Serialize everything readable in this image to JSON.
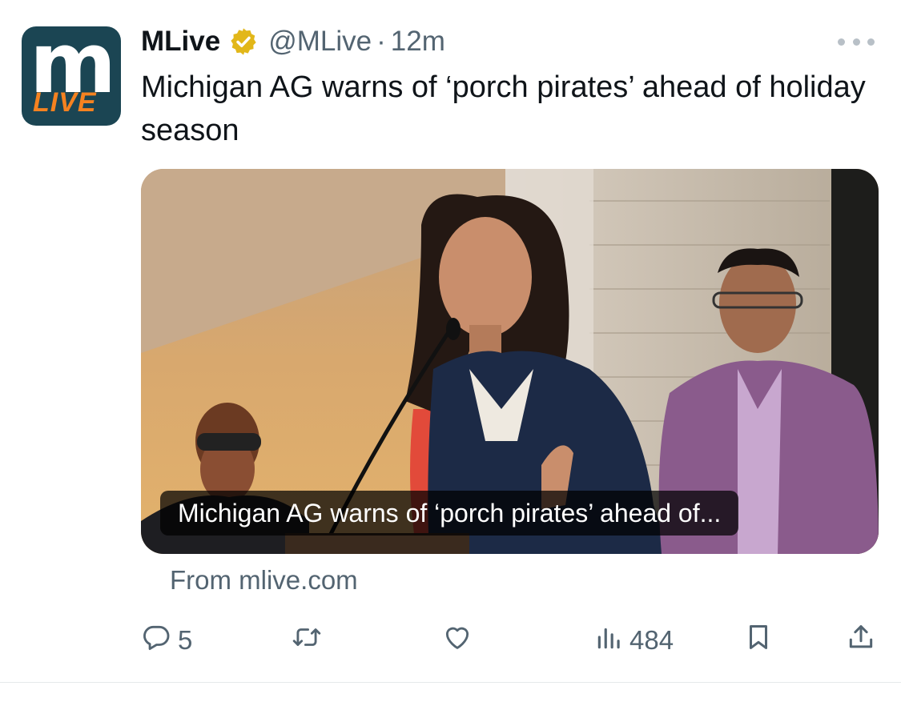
{
  "author": {
    "name": "MLive",
    "handle": "@MLive",
    "separator": "·",
    "time": "12m",
    "avatar_text_main": "m",
    "avatar_text_sub": "LIVE"
  },
  "tweet": {
    "text": "Michigan AG warns of ‘porch pirates’ ahead of holiday season"
  },
  "link_card": {
    "caption": "Michigan AG warns of ‘porch pirates’ ahead of...",
    "source": "From mlive.com"
  },
  "actions": {
    "replies": "5",
    "views": "484"
  },
  "icons": {
    "verified": "verified-badge-icon",
    "more": "more-dots-icon",
    "reply": "reply-icon",
    "retweet": "retweet-icon",
    "like": "heart-icon",
    "views": "views-chart-icon",
    "bookmark": "bookmark-icon",
    "share": "share-icon"
  },
  "colors": {
    "text_primary": "#0f1419",
    "text_secondary": "#536471",
    "verified_gold": "#e2b719",
    "avatar_bg": "#1b4553",
    "avatar_accent": "#f58220"
  }
}
